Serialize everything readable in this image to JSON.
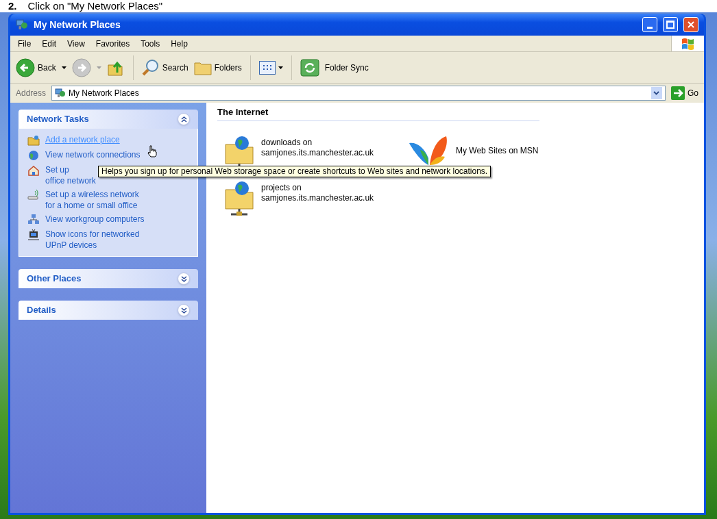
{
  "caption": {
    "number": "2.",
    "text": "Click on \"My Network Places\""
  },
  "window": {
    "title": "My Network Places"
  },
  "menu": [
    "File",
    "Edit",
    "View",
    "Favorites",
    "Tools",
    "Help"
  ],
  "toolbar": [
    {
      "kind": "back",
      "label": "Back",
      "disabled": false
    },
    {
      "kind": "forward",
      "disabled": true
    },
    {
      "kind": "up"
    },
    {
      "kind": "search",
      "label": "Search"
    },
    {
      "kind": "folders",
      "label": "Folders"
    },
    {
      "kind": "views"
    },
    {
      "kind": "sync",
      "label": "Folder Sync"
    }
  ],
  "address": {
    "label": "Address",
    "value": "My Network Places",
    "go": "Go"
  },
  "panels": [
    {
      "title": "Network Tasks",
      "expanded": true,
      "items": [
        {
          "lines": [
            "Add a network place"
          ],
          "hover": true
        },
        {
          "lines": [
            "View network connections"
          ],
          "hover": false
        },
        {
          "lines": [
            "Set up",
            "office network"
          ],
          "hover": false
        },
        {
          "lines": [
            "Set up a wireless network",
            "for a home or small office"
          ],
          "hover": false
        },
        {
          "lines": [
            "View workgroup computers"
          ],
          "hover": false
        },
        {
          "lines": [
            "Show icons for networked",
            "UPnP devices"
          ],
          "hover": false
        }
      ]
    },
    {
      "title": "Other Places",
      "expanded": false
    },
    {
      "title": "Details",
      "expanded": false
    }
  ],
  "group": {
    "title": "The Internet",
    "items": [
      {
        "kind": "network-folder",
        "lines": [
          "downloads on",
          "samjones.its.manchester.ac.uk"
        ]
      },
      {
        "kind": "msn",
        "lines": [
          "My Web Sites on MSN"
        ]
      },
      {
        "kind": "network-folder",
        "lines": [
          "projects on",
          "samjones.its.manchester.ac.uk"
        ]
      }
    ]
  },
  "tooltip": "Helps you sign up for personal Web storage space or create shortcuts to Web sites and network locations."
}
